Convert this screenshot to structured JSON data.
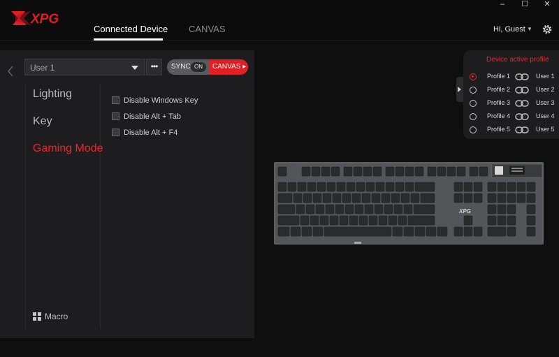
{
  "app": {
    "logo_text": "XPG"
  },
  "window_controls": {
    "minimize": "–",
    "maximize": "☐",
    "close": "✕"
  },
  "nav": {
    "tabs": [
      {
        "label": "Connected Device"
      },
      {
        "label": "CANVAS"
      }
    ]
  },
  "user": {
    "greeting": "Hi, Guest"
  },
  "panel": {
    "user_select": "User 1",
    "more": "•••",
    "sync_label": "SYNC",
    "sync_state": "ON",
    "canvas_button": "CANVAS ▸",
    "menu": [
      {
        "label": "Lighting"
      },
      {
        "label": "Key"
      },
      {
        "label": "Gaming Mode"
      }
    ],
    "macro": "Macro",
    "options": [
      {
        "label": "Disable Windows Key",
        "checked": false
      },
      {
        "label": "Disable Alt + Tab",
        "checked": false
      },
      {
        "label": "Disable Alt + F4",
        "checked": false
      }
    ]
  },
  "profiles": {
    "title": "Device active profile",
    "items": [
      {
        "name": "Profile 1",
        "user": "User 1",
        "active": true
      },
      {
        "name": "Profile 2",
        "user": "User 2",
        "active": false
      },
      {
        "name": "Profile 3",
        "user": "User 3",
        "active": false
      },
      {
        "name": "Profile 4",
        "user": "User 4",
        "active": false
      },
      {
        "name": "Profile 5",
        "user": "User 5",
        "active": false
      }
    ]
  },
  "keyboard": {
    "brand": "XPG"
  },
  "colors": {
    "accent": "#e01e24",
    "panel": "#1d1d1f",
    "background": "#0f0f10"
  }
}
